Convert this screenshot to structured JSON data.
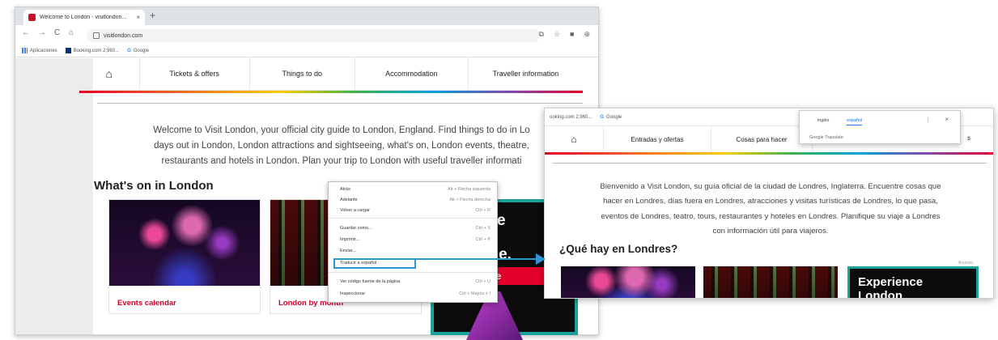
{
  "left_browser": {
    "tab_title": "Welcome to London - visitlondon...",
    "tab_close": "×",
    "new_tab": "+",
    "nav_back": "←",
    "nav_forward": "→",
    "nav_reload": "C",
    "nav_home": "⌂",
    "url": "visitlondon.com",
    "bookmarks": [
      "Aplicaciones",
      "Booking.com 2,960...",
      "Google"
    ],
    "nav_items": [
      "Tickets & offers",
      "Things to do",
      "Accommodation",
      "Traveller information"
    ],
    "intro_lines": [
      "Welcome to Visit London, your official city guide to London, England. Find things to do in Lo",
      "days out in London, London attractions and sightseeing, what's on, London events, theatre,",
      "restaurants and hotels in London. Plan your trip to London with useful traveller informati"
    ],
    "section_title": "What's on in London",
    "cards": [
      {
        "label": "Events calendar"
      },
      {
        "label": "London by month"
      }
    ],
    "ad": {
      "lines": [
        "ience",
        "n",
        "home."
      ],
      "button": "r more"
    },
    "context_menu": [
      {
        "label": "Atrás",
        "shortcut": "Alt + Flecha izquierda"
      },
      {
        "label": "Adelante",
        "shortcut": "Alt + Flecha derecha"
      },
      {
        "label": "Volver a cargar",
        "shortcut": "Ctrl + R"
      },
      {
        "label": "Guardar como...",
        "shortcut": "Ctrl + S"
      },
      {
        "label": "Imprimir...",
        "shortcut": "Ctrl + P"
      },
      {
        "label": "Enviar...",
        "shortcut": ""
      },
      {
        "label": "Traducir a español",
        "shortcut": ""
      },
      {
        "label": "Ver código fuente de la página",
        "shortcut": "Ctrl + U"
      },
      {
        "label": "Inspeccionar",
        "shortcut": "Ctrl + Mayús + I"
      }
    ]
  },
  "right_browser": {
    "bookmarks": [
      "ooking.com 2,960...",
      "Google"
    ],
    "nav_items": [
      "Entradas y ofertas",
      "Cosas para hacer"
    ],
    "nav_cutoff": "s",
    "translate_popup": {
      "lang_source": "inglés",
      "lang_target": "español",
      "menu": "⋮",
      "close": "×",
      "brand": "Google Translate"
    },
    "intro_lines": [
      "Bienvenido a Visit London, su guía oficial de la ciudad de Londres, Inglaterra. Encuentre cosas que",
      "hacer en Londres, días fuera en Londres, atracciones y visitas turísticas de Londres, lo que pasa,",
      "eventos de Londres, teatro, tours, restaurantes y hoteles en Londres. Planifique su viaje a Londres",
      "con información útil para viajeros."
    ],
    "section_title": "¿Qué hay en Londres?",
    "ad_label": "Anuncio",
    "ad_lines": [
      "Experience",
      "London"
    ]
  },
  "colors": {
    "accent_red": "#d6002a",
    "highlight_blue": "#2a97d4",
    "ad_teal": "#1aa39a"
  }
}
